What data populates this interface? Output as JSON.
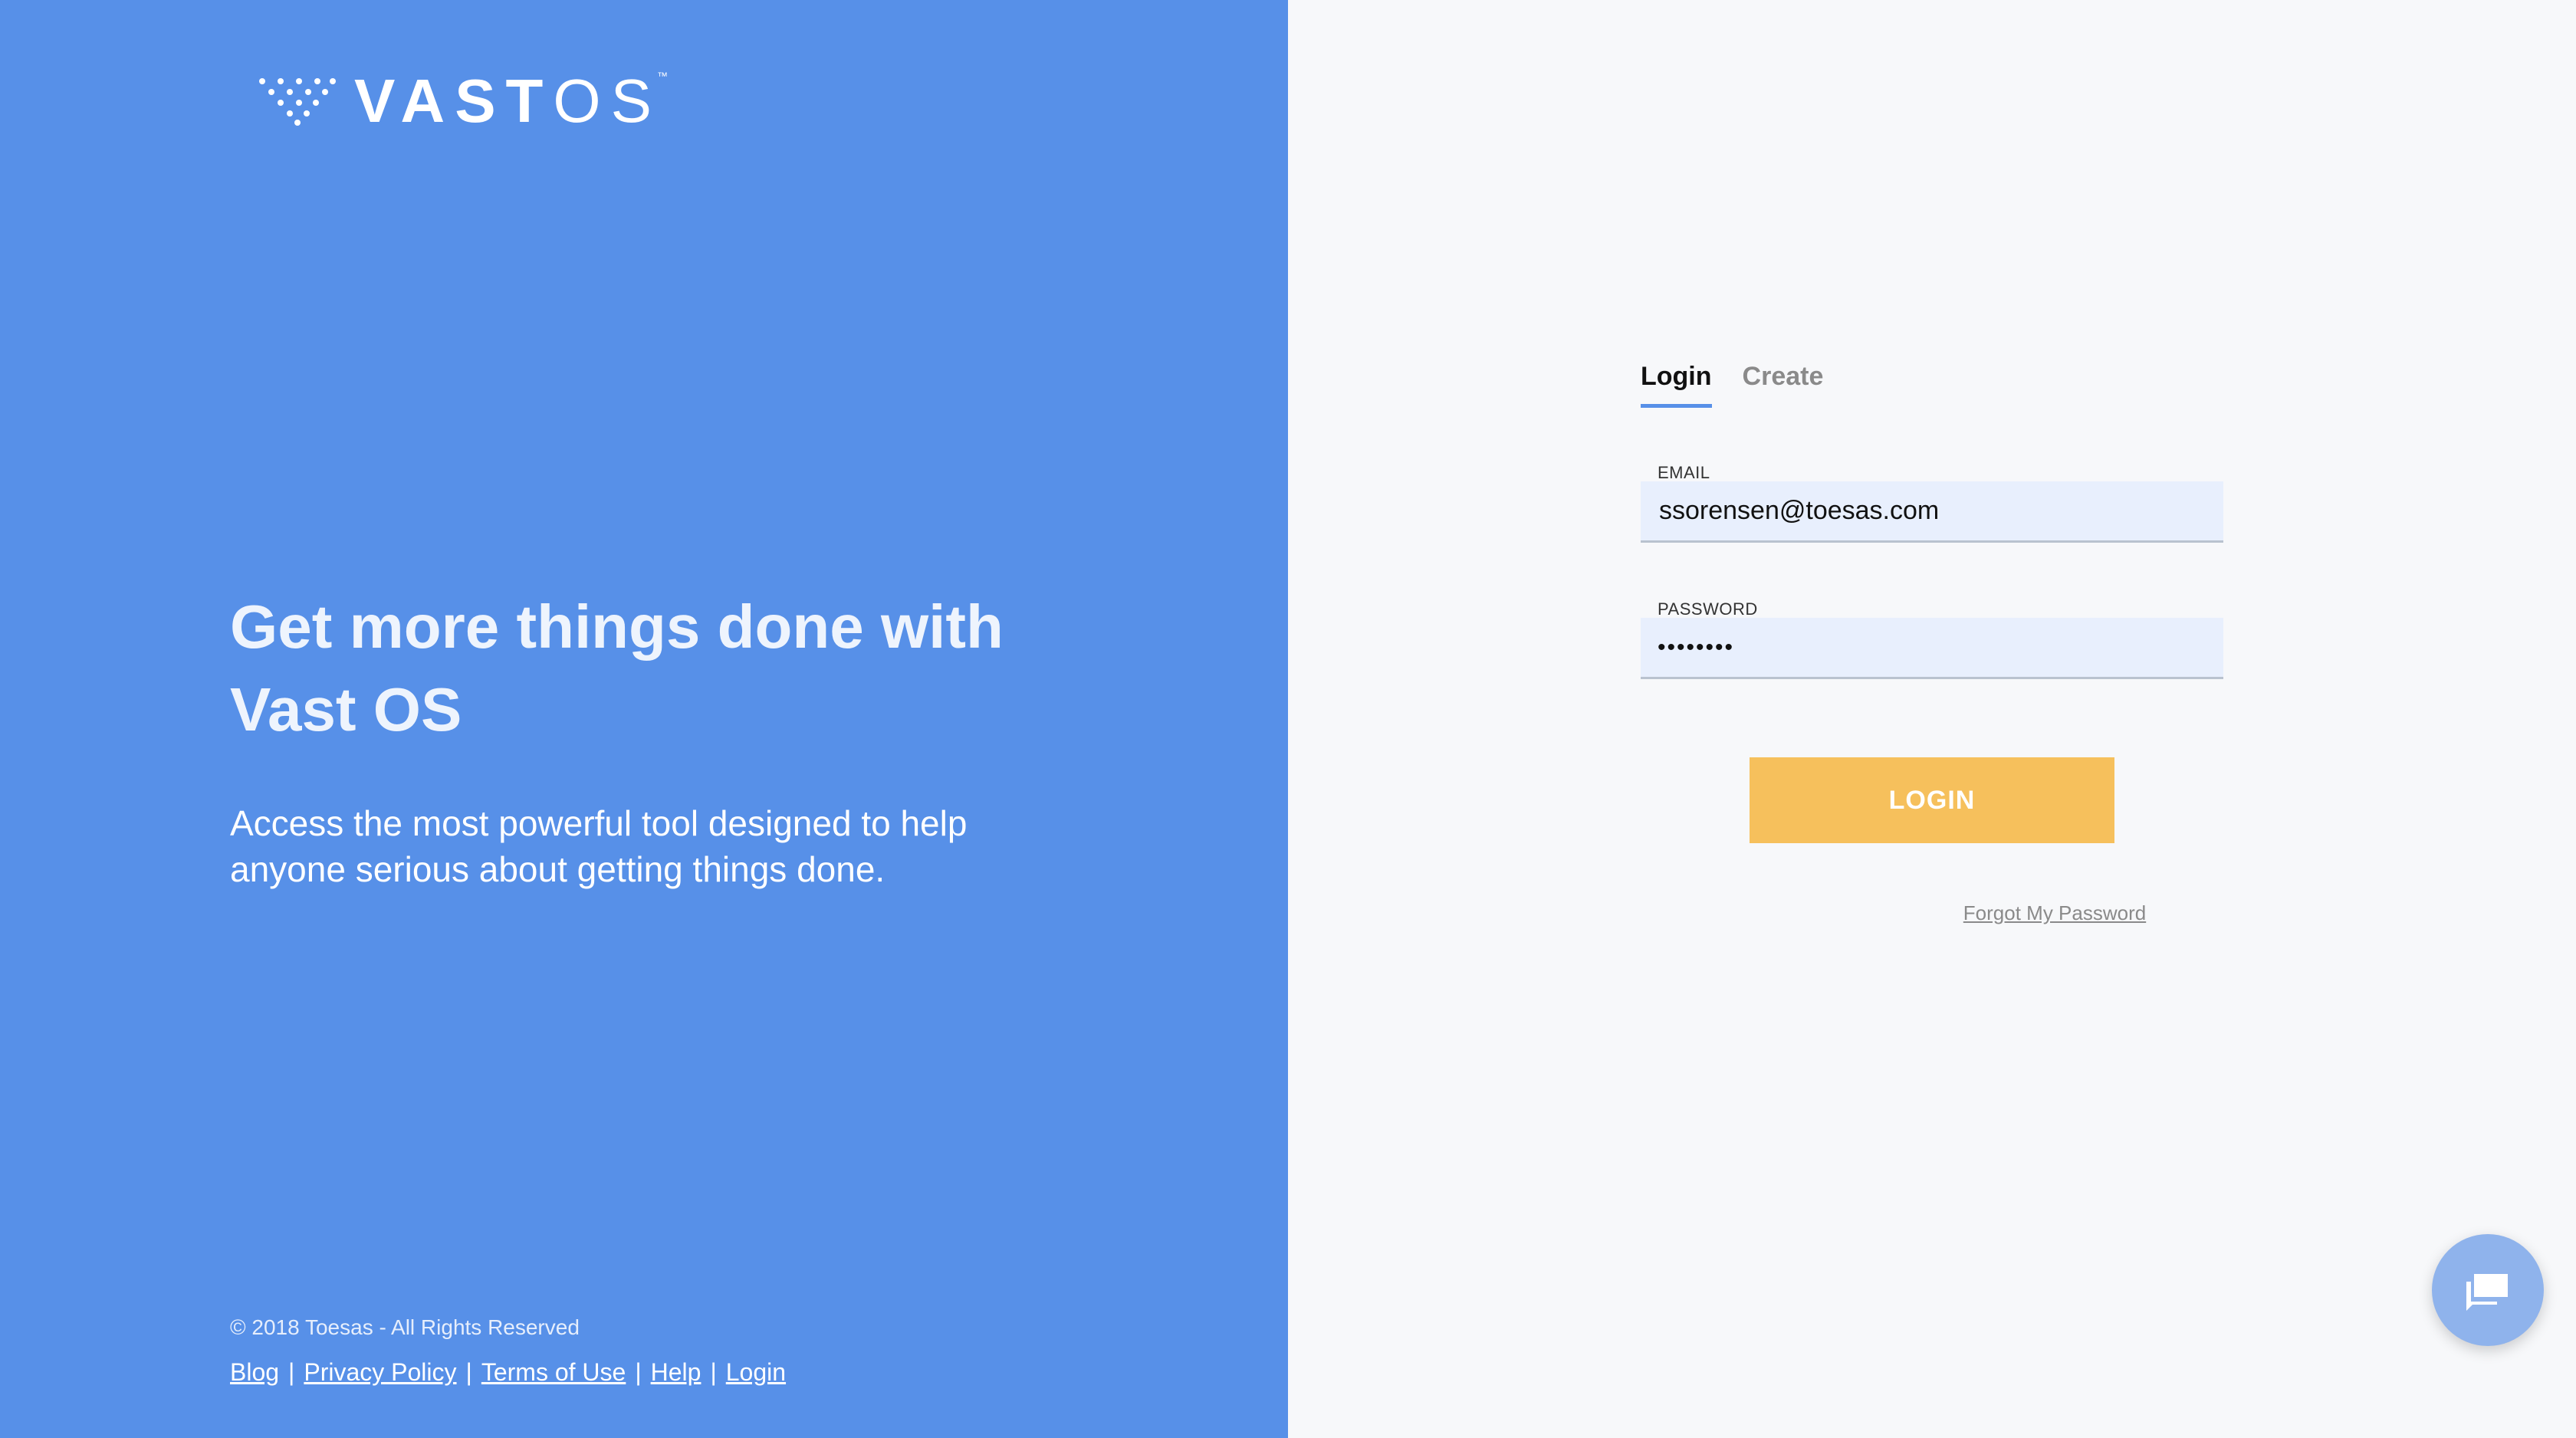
{
  "brand": {
    "name_prefix": "VAST",
    "name_suffix": "OS",
    "trademark": "™",
    "logo_icon": "dot-triangle-icon"
  },
  "hero": {
    "headline": "Get more things done with Vast OS",
    "subline": "Access the most powerful tool designed to help anyone serious about getting things done."
  },
  "footer": {
    "copyright": "© 2018 Toesas - All Rights Reserved",
    "links": [
      "Blog",
      "Privacy Policy",
      "Terms of Use",
      "Help",
      "Login"
    ],
    "separator": "|"
  },
  "auth": {
    "tabs": [
      {
        "label": "Login",
        "active": true
      },
      {
        "label": "Create",
        "active": false
      }
    ],
    "email": {
      "label": "EMAIL",
      "value": "ssorensen@toesas.com"
    },
    "password": {
      "label": "PASSWORD",
      "masked_value": "••••••••"
    },
    "submit_label": "LOGIN",
    "forgot_label": "Forgot My Password"
  },
  "chat": {
    "icon": "chat-bubble-icon"
  },
  "colors": {
    "hero_bg": "#5790e8",
    "panel_bg": "#f7f8fa",
    "input_bg": "#e8effd",
    "button_bg": "#f6c05c",
    "tab_accent": "#5790e8"
  }
}
